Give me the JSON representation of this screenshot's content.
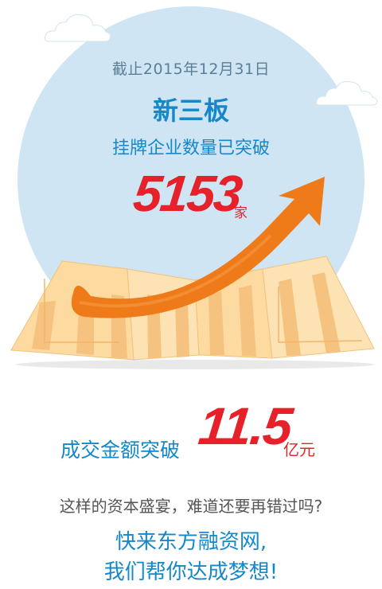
{
  "header": {
    "date_text": "截止2015年12月31日",
    "title": "新三板",
    "subtitle": "挂牌企业数量已突破"
  },
  "stat_companies": {
    "value": "5153",
    "unit": "家"
  },
  "stat_volume": {
    "label": "成交金额突破",
    "value": "11.5",
    "unit": "亿元"
  },
  "footer": {
    "question": "这样的资本盛宴，难道还要再错过吗?",
    "cta_line1": "快来东方融资网,",
    "cta_line2": "我们帮你达成梦想!"
  },
  "colors": {
    "circle": "#cfe5f3",
    "blue_text": "#1588c9",
    "red_number": "#e6212a",
    "arrow": "#ef7a1a",
    "map": "#fbd79b"
  },
  "icons": [
    "cloud-icon",
    "map-illustration",
    "growth-arrow-icon"
  ]
}
